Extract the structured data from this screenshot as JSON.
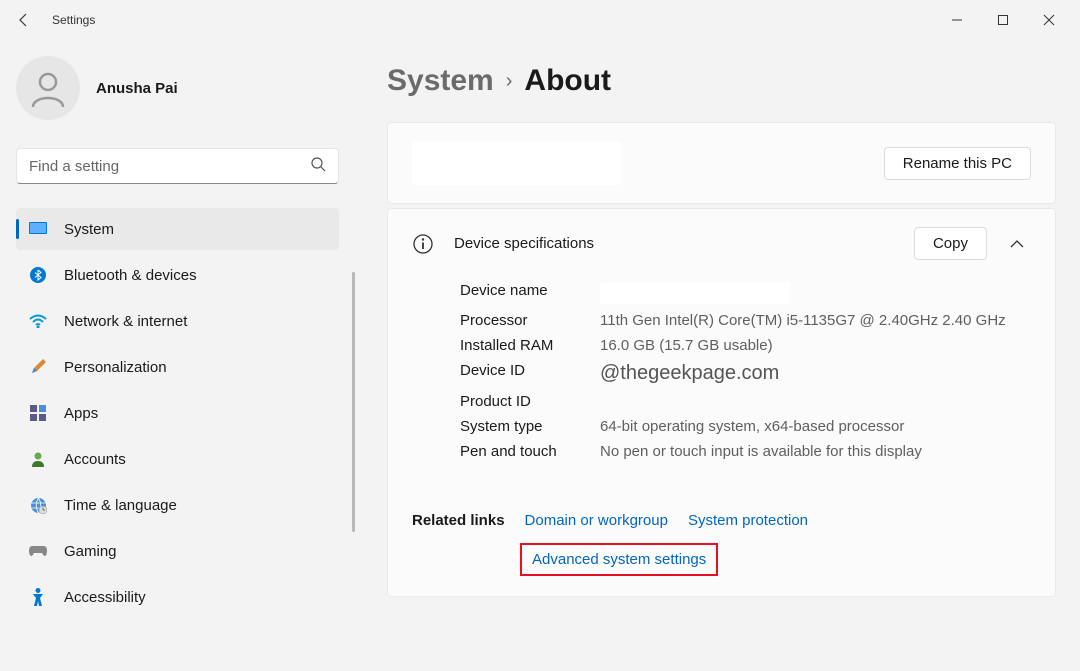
{
  "titlebar": {
    "title": "Settings"
  },
  "user": {
    "name": "Anusha Pai"
  },
  "search": {
    "placeholder": "Find a setting"
  },
  "nav": [
    {
      "label": "System",
      "icon": "system"
    },
    {
      "label": "Bluetooth & devices",
      "icon": "bluetooth"
    },
    {
      "label": "Network & internet",
      "icon": "wifi"
    },
    {
      "label": "Personalization",
      "icon": "brush"
    },
    {
      "label": "Apps",
      "icon": "apps"
    },
    {
      "label": "Accounts",
      "icon": "person"
    },
    {
      "label": "Time & language",
      "icon": "globe"
    },
    {
      "label": "Gaming",
      "icon": "gamepad"
    },
    {
      "label": "Accessibility",
      "icon": "access"
    }
  ],
  "breadcrumb": {
    "parent": "System",
    "current": "About"
  },
  "rename": {
    "button": "Rename this PC"
  },
  "specs": {
    "heading": "Device specifications",
    "copy_button": "Copy",
    "rows": {
      "device_name_label": "Device name",
      "processor_label": "Processor",
      "processor_value": "11th Gen Intel(R) Core(TM) i5-1135G7 @ 2.40GHz   2.40 GHz",
      "ram_label": "Installed RAM",
      "ram_value": "16.0 GB (15.7 GB usable)",
      "device_id_label": "Device ID",
      "watermark": "@thegeekpage.com",
      "product_id_label": "Product ID",
      "system_type_label": "System type",
      "system_type_value": "64-bit operating system, x64-based processor",
      "pen_label": "Pen and touch",
      "pen_value": "No pen or touch input is available for this display"
    }
  },
  "related": {
    "label": "Related links",
    "links": {
      "domain": "Domain or workgroup",
      "protection": "System protection",
      "advanced": "Advanced system settings"
    }
  }
}
